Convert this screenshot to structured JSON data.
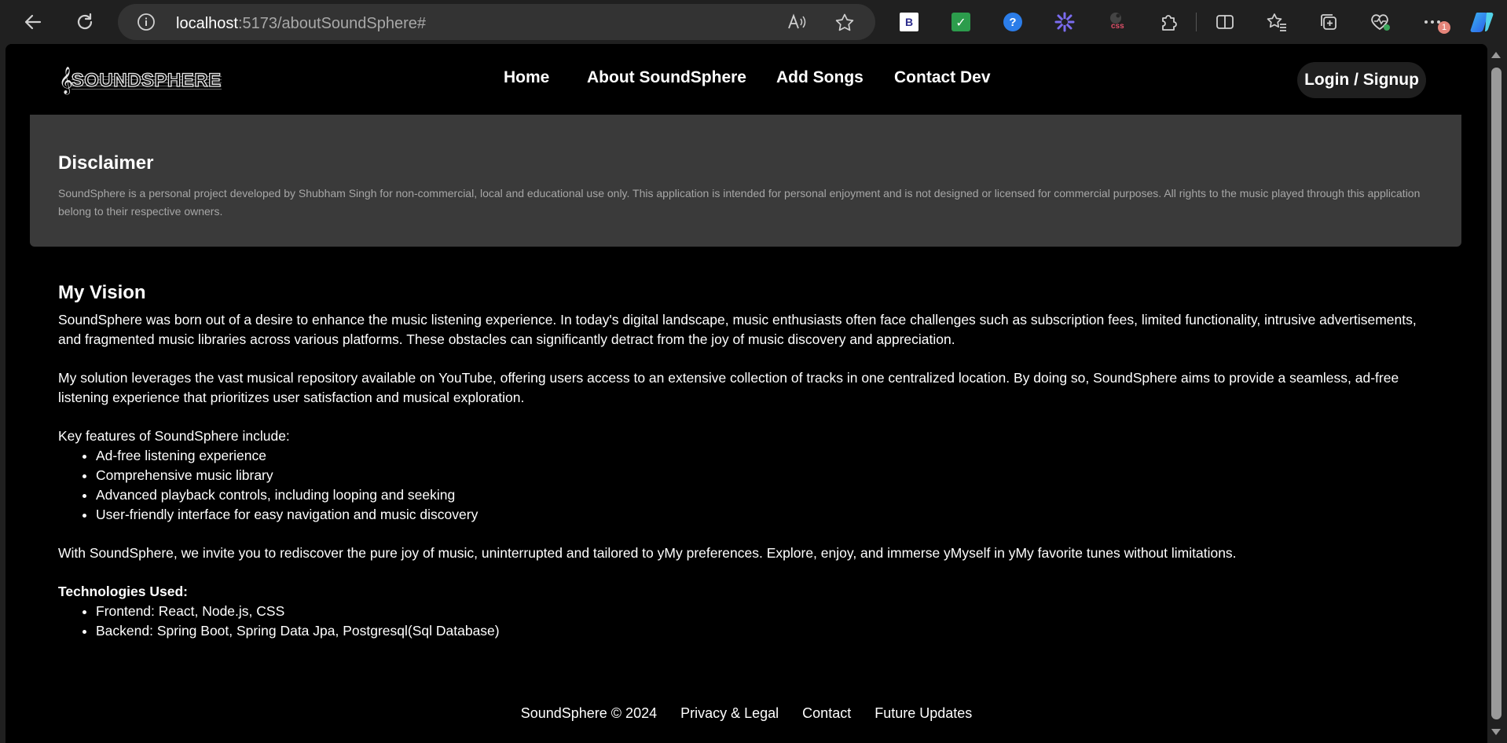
{
  "browser": {
    "url_host": "localhost",
    "url_path": ":5173/aboutSoundSphere#",
    "extension_b_label": "B",
    "extension_css_label": "css",
    "notification_badge": "1"
  },
  "header": {
    "logo_text": "SOUNDSPHERE",
    "nav": [
      {
        "label": "Home"
      },
      {
        "label": "About SoundSphere"
      },
      {
        "label": "Add Songs"
      },
      {
        "label": "Contact Dev"
      }
    ],
    "login_label": "Login / Signup"
  },
  "disclaimer": {
    "title": "Disclaimer",
    "text": "SoundSphere is a personal project developed by Shubham Singh for non-commercial, local and educational use only. This application is intended for personal enjoyment and is not designed or licensed for commercial purposes. All rights to the music played through this application belong to their respective owners."
  },
  "vision": {
    "title": "My Vision",
    "p1": "SoundSphere was born out of a desire to enhance the music listening experience. In today's digital landscape, music enthusiasts often face challenges such as subscription fees, limited functionality, intrusive advertisements, and fragmented music libraries across various platforms. These obstacles can significantly detract from the joy of music discovery and appreciation.",
    "p2": "My solution leverages the vast musical repository available on YouTube, offering users access to an extensive collection of tracks in one centralized location. By doing so, SoundSphere aims to provide a seamless, ad-free listening experience that prioritizes user satisfaction and musical exploration.",
    "features_intro": "Key features of SoundSphere include:",
    "features": [
      "Ad-free listening experience",
      "Comprehensive music library",
      "Advanced playback controls, including looping and seeking",
      "User-friendly interface for easy navigation and music discovery"
    ],
    "p3": "With SoundSphere, we invite you to rediscover the pure joy of music, uninterrupted and tailored to yMy preferences. Explore, enjoy, and immerse yMyself in yMy favorite tunes without limitations.",
    "tech_title": "Technologies Used:",
    "tech": [
      "Frontend: React, Node.js, CSS",
      "Backend: Spring Boot, Spring Data Jpa, Postgresql(Sql Database)"
    ]
  },
  "footer": {
    "copyright": "SoundSphere © 2024",
    "links": [
      "Privacy & Legal",
      "Contact",
      "Future Updates"
    ]
  }
}
